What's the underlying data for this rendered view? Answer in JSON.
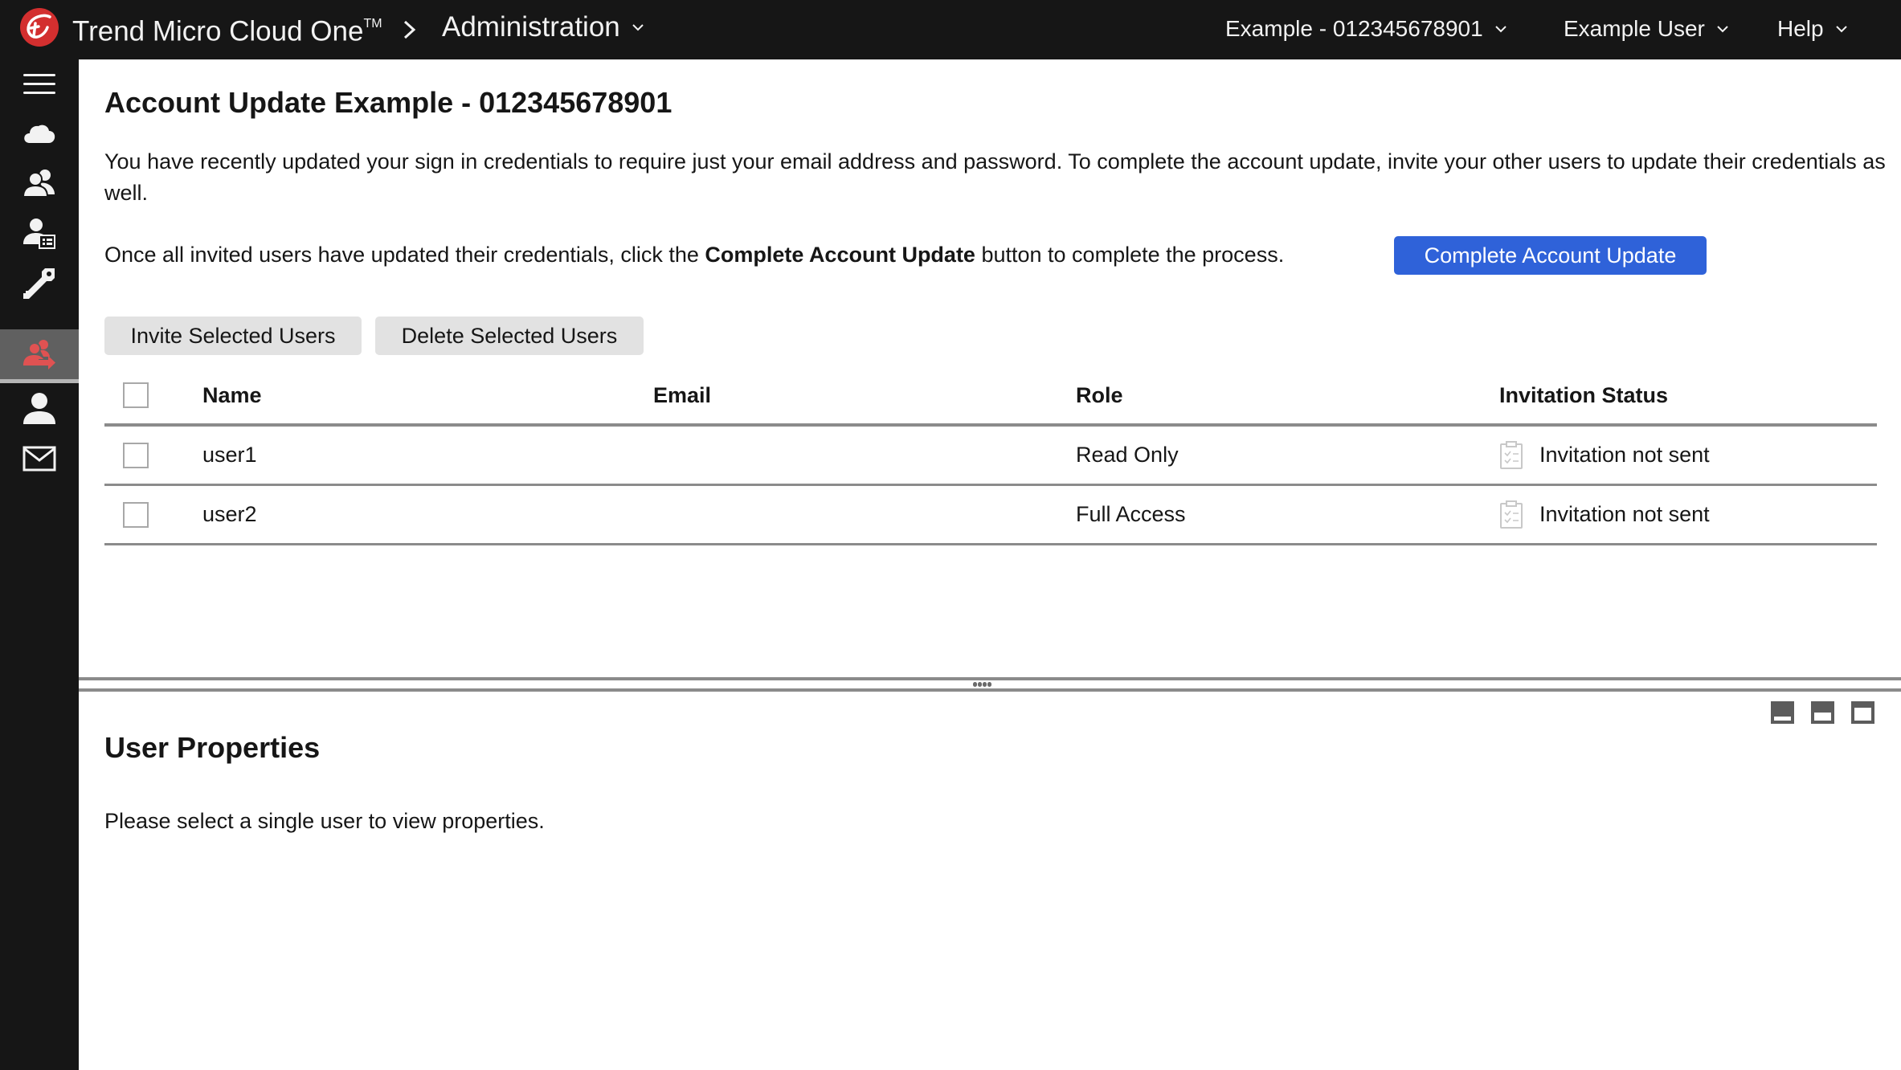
{
  "header": {
    "brand": "Trend Micro Cloud One",
    "brand_mark": "TM",
    "app_menu_label": "Administration",
    "account_menu_label": "Example - 012345678901",
    "user_menu_label": "Example User",
    "help_menu_label": "Help",
    "logo_icon": "trend-micro-logo",
    "separator_icon": "chevron-right-icon"
  },
  "sidebar": {
    "items": [
      {
        "name": "menu",
        "icon": "hamburger-icon",
        "active": false
      },
      {
        "name": "cloud",
        "icon": "cloud-icon",
        "active": false
      },
      {
        "name": "users",
        "icon": "users-icon",
        "active": false
      },
      {
        "name": "roles",
        "icon": "user-card-icon",
        "active": false
      },
      {
        "name": "api-keys",
        "icon": "key-icon",
        "active": false
      },
      {
        "name": "account-update",
        "icon": "users-arrow-icon",
        "active": true
      },
      {
        "name": "profile",
        "icon": "user-icon",
        "active": false
      },
      {
        "name": "messages",
        "icon": "envelope-icon",
        "active": false
      }
    ],
    "active_color": "#e05252"
  },
  "main": {
    "title": "Account Update Example - 012345678901",
    "intro": "You have recently updated your sign in credentials to require just your email address and password. To complete the account update, invite your other users to update their credentials as well.",
    "instruction_prefix": "Once all invited users have updated their credentials, click the ",
    "instruction_bold": "Complete Account Update",
    "instruction_suffix": " button to complete the process.",
    "complete_button": "Complete Account Update",
    "invite_button": "Invite Selected Users",
    "delete_button": "Delete Selected Users",
    "primary_color": "#2f62d9"
  },
  "table": {
    "columns": [
      "Name",
      "Email",
      "Role",
      "Invitation Status"
    ],
    "rows": [
      {
        "name": "user1",
        "email": "",
        "role": "Read Only",
        "status": "Invitation not sent",
        "checked": false
      },
      {
        "name": "user2",
        "email": "",
        "role": "Full Access",
        "status": "Invitation not sent",
        "checked": false
      }
    ],
    "select_all_checked": false
  },
  "properties": {
    "title": "User Properties",
    "empty_message": "Please select a single user to view properties.",
    "pane_buttons": [
      "minimize-pane",
      "half-pane",
      "maximize-pane"
    ]
  }
}
